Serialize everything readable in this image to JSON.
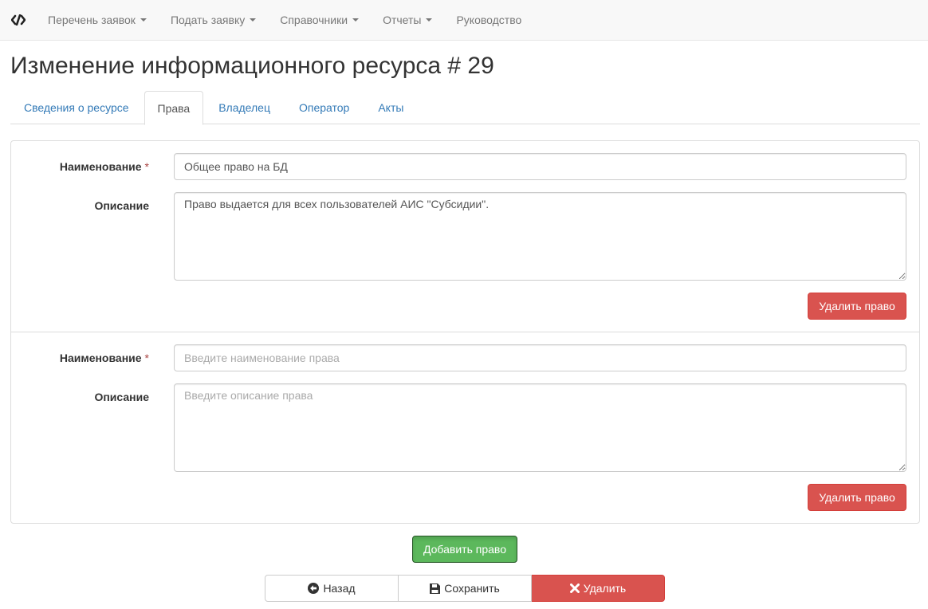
{
  "nav": {
    "items": [
      {
        "label": "Перечень заявок",
        "dropdown": true
      },
      {
        "label": "Подать заявку",
        "dropdown": true
      },
      {
        "label": "Справочники",
        "dropdown": true
      },
      {
        "label": "Отчеты",
        "dropdown": true
      },
      {
        "label": "Руководство",
        "dropdown": false
      }
    ]
  },
  "page": {
    "title": "Изменение информационного ресурса # 29"
  },
  "tabs": [
    {
      "label": "Сведения о ресурсе",
      "active": false
    },
    {
      "label": "Права",
      "active": true
    },
    {
      "label": "Владелец",
      "active": false
    },
    {
      "label": "Оператор",
      "active": false
    },
    {
      "label": "Акты",
      "active": false
    }
  ],
  "rights": [
    {
      "name_label": "Наименование",
      "required_mark": "*",
      "name_value": "Общее право на БД",
      "name_placeholder": "Введите наименование права",
      "desc_label": "Описание",
      "desc_value": "Право выдается для всех пользователей АИС \"Субсидии\".",
      "desc_placeholder": "Введите описание права",
      "delete_label": "Удалить право"
    },
    {
      "name_label": "Наименование",
      "required_mark": "*",
      "name_value": "",
      "name_placeholder": "Введите наименование права",
      "desc_label": "Описание",
      "desc_value": "",
      "desc_placeholder": "Введите описание права",
      "delete_label": "Удалить право"
    }
  ],
  "actions": {
    "add_label": "Добавить право",
    "back_label": "Назад",
    "save_label": "Сохранить",
    "delete_label": "Удалить"
  },
  "colors": {
    "primary_link": "#337ab7",
    "danger": "#d9534f",
    "success": "#5cb85c"
  }
}
